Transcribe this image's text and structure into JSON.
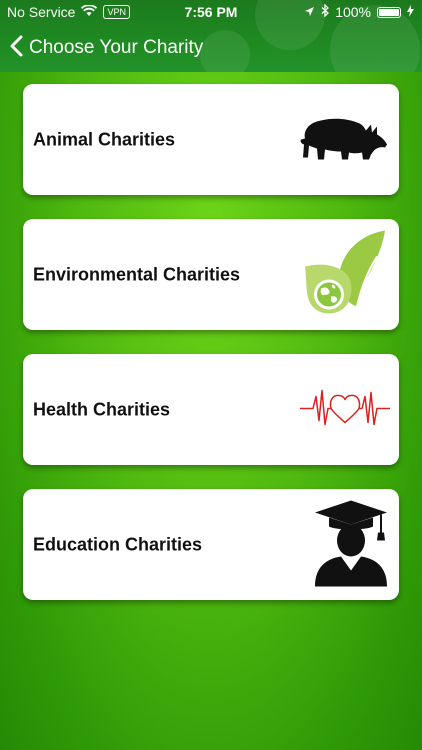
{
  "status_bar": {
    "carrier": "No Service",
    "vpn": "VPN",
    "time": "7:56 PM",
    "battery": "100%"
  },
  "nav": {
    "title": "Choose Your Charity"
  },
  "cards": [
    {
      "label": "Animal Charities",
      "icon": "rhino-icon"
    },
    {
      "label": "Environmental Charities",
      "icon": "leaf-globe-icon"
    },
    {
      "label": "Health Charities",
      "icon": "heartbeat-icon"
    },
    {
      "label": "Education Charities",
      "icon": "graduate-icon"
    }
  ],
  "colors": {
    "background": "#4fb80f",
    "header": "#1f8a22",
    "heartbeat": "#d9221e",
    "leaf": "#8cc63f"
  }
}
